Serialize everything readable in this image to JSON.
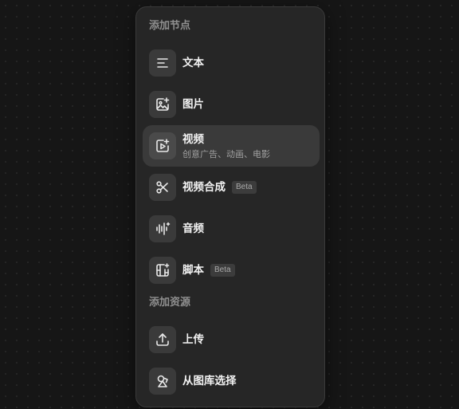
{
  "sections": {
    "add_node": {
      "title": "添加节点",
      "items": [
        {
          "label": "文本",
          "icon": "text-lines-icon"
        },
        {
          "label": "图片",
          "icon": "image-sparkle-icon"
        },
        {
          "label": "视频",
          "subtitle": "创意广告、动画、电影",
          "icon": "video-sparkle-icon",
          "selected": true
        },
        {
          "label": "视频合成",
          "badge": "Beta",
          "icon": "scissors-icon"
        },
        {
          "label": "音频",
          "icon": "audio-wave-icon"
        },
        {
          "label": "脚本",
          "badge": "Beta",
          "icon": "film-script-icon"
        }
      ]
    },
    "add_resource": {
      "title": "添加资源",
      "items": [
        {
          "label": "上传",
          "icon": "upload-icon"
        },
        {
          "label": "从图库选择",
          "icon": "gallery-shapes-icon"
        }
      ]
    }
  },
  "colors": {
    "background": "#161616",
    "panel": "#262626",
    "selected": "#3a3a3a",
    "icon_box": "#3a3a3a",
    "text_primary": "#f2f2f2",
    "text_secondary": "#8f8f8f"
  }
}
